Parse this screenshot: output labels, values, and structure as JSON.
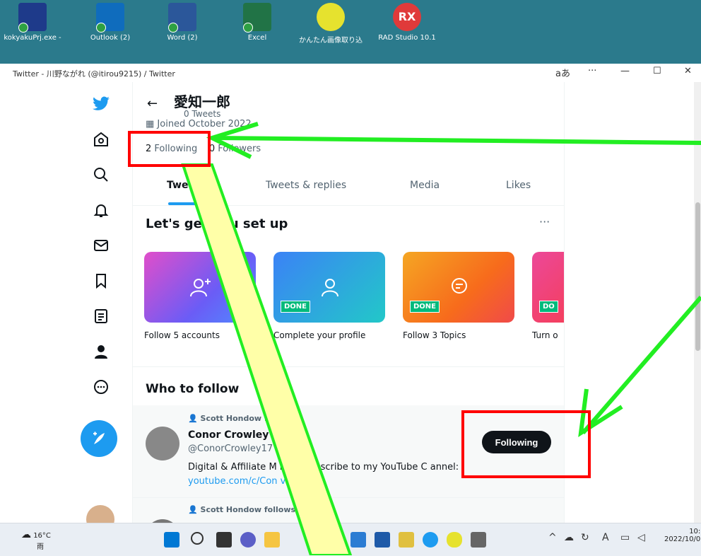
{
  "desktop": {
    "icons": [
      {
        "label": "kokyakuPrj.exe -",
        "color": "#1e3a8a"
      },
      {
        "label": "Outlook (2)",
        "color": "#0f6cbd"
      },
      {
        "label": "Word (2)",
        "color": "#2b579a"
      },
      {
        "label": "Excel",
        "color": "#217346"
      },
      {
        "label": "かんたん画像取り込",
        "color": "#e6e22e"
      },
      {
        "label": "RAD Studio 10.1",
        "color": "#e03a3a"
      }
    ]
  },
  "window": {
    "title": "Twitter - 川野ながれ (@itirou9215) / Twitter",
    "reader": "aあ",
    "menu": "···",
    "minimize": "—",
    "maximize": "☐",
    "close": "✕"
  },
  "profile": {
    "back": "←",
    "name": "愛知一郎",
    "tweet_count": "0 Tweets",
    "joined": "Joined October 2022",
    "following_count": "2",
    "following_label": "Following",
    "followers_count": "0",
    "followers_label": "Followers"
  },
  "tabs": [
    "Tweets",
    "Tweets & replies",
    "Media",
    "Likes"
  ],
  "setup": {
    "title": "Let's get you set up",
    "more": "···",
    "cards": [
      {
        "label": "Follow 5 accounts",
        "done": "",
        "icon": "add-user-icon"
      },
      {
        "label": "Complete your profile",
        "done": "DONE",
        "icon": "user-icon"
      },
      {
        "label": "Follow 3 Topics",
        "done": "DONE",
        "icon": "topic-icon"
      },
      {
        "label": "Turn o",
        "done": "DO",
        "icon": "notification-icon"
      }
    ]
  },
  "who_to_follow": {
    "title": "Who to follow",
    "rows": [
      {
        "social": "Scott Hondow fol",
        "name": "Conor Crowley",
        "handle": "@ConorCrowley17",
        "bio": "Digital & Affiliate M    ing - Subscribe to my YouTube C   annel:",
        "link": "youtube.com/c/Con       vley",
        "button": "Following"
      },
      {
        "social": "Scott Hondow follows",
        "name": "",
        "handle": "",
        "bio": "",
        "link": "",
        "button": ""
      }
    ]
  },
  "taskbar": {
    "temperature": "16°C",
    "weather": "雨",
    "time": "10:",
    "date": "2022/10/0",
    "tray_up": "^",
    "tray_ime": "A"
  },
  "colors": {
    "twitter_blue": "#1d9bf0",
    "annotation_green": "#22ee22",
    "annotation_red": "#ff0000",
    "annotation_fill": "#ffffa8"
  }
}
